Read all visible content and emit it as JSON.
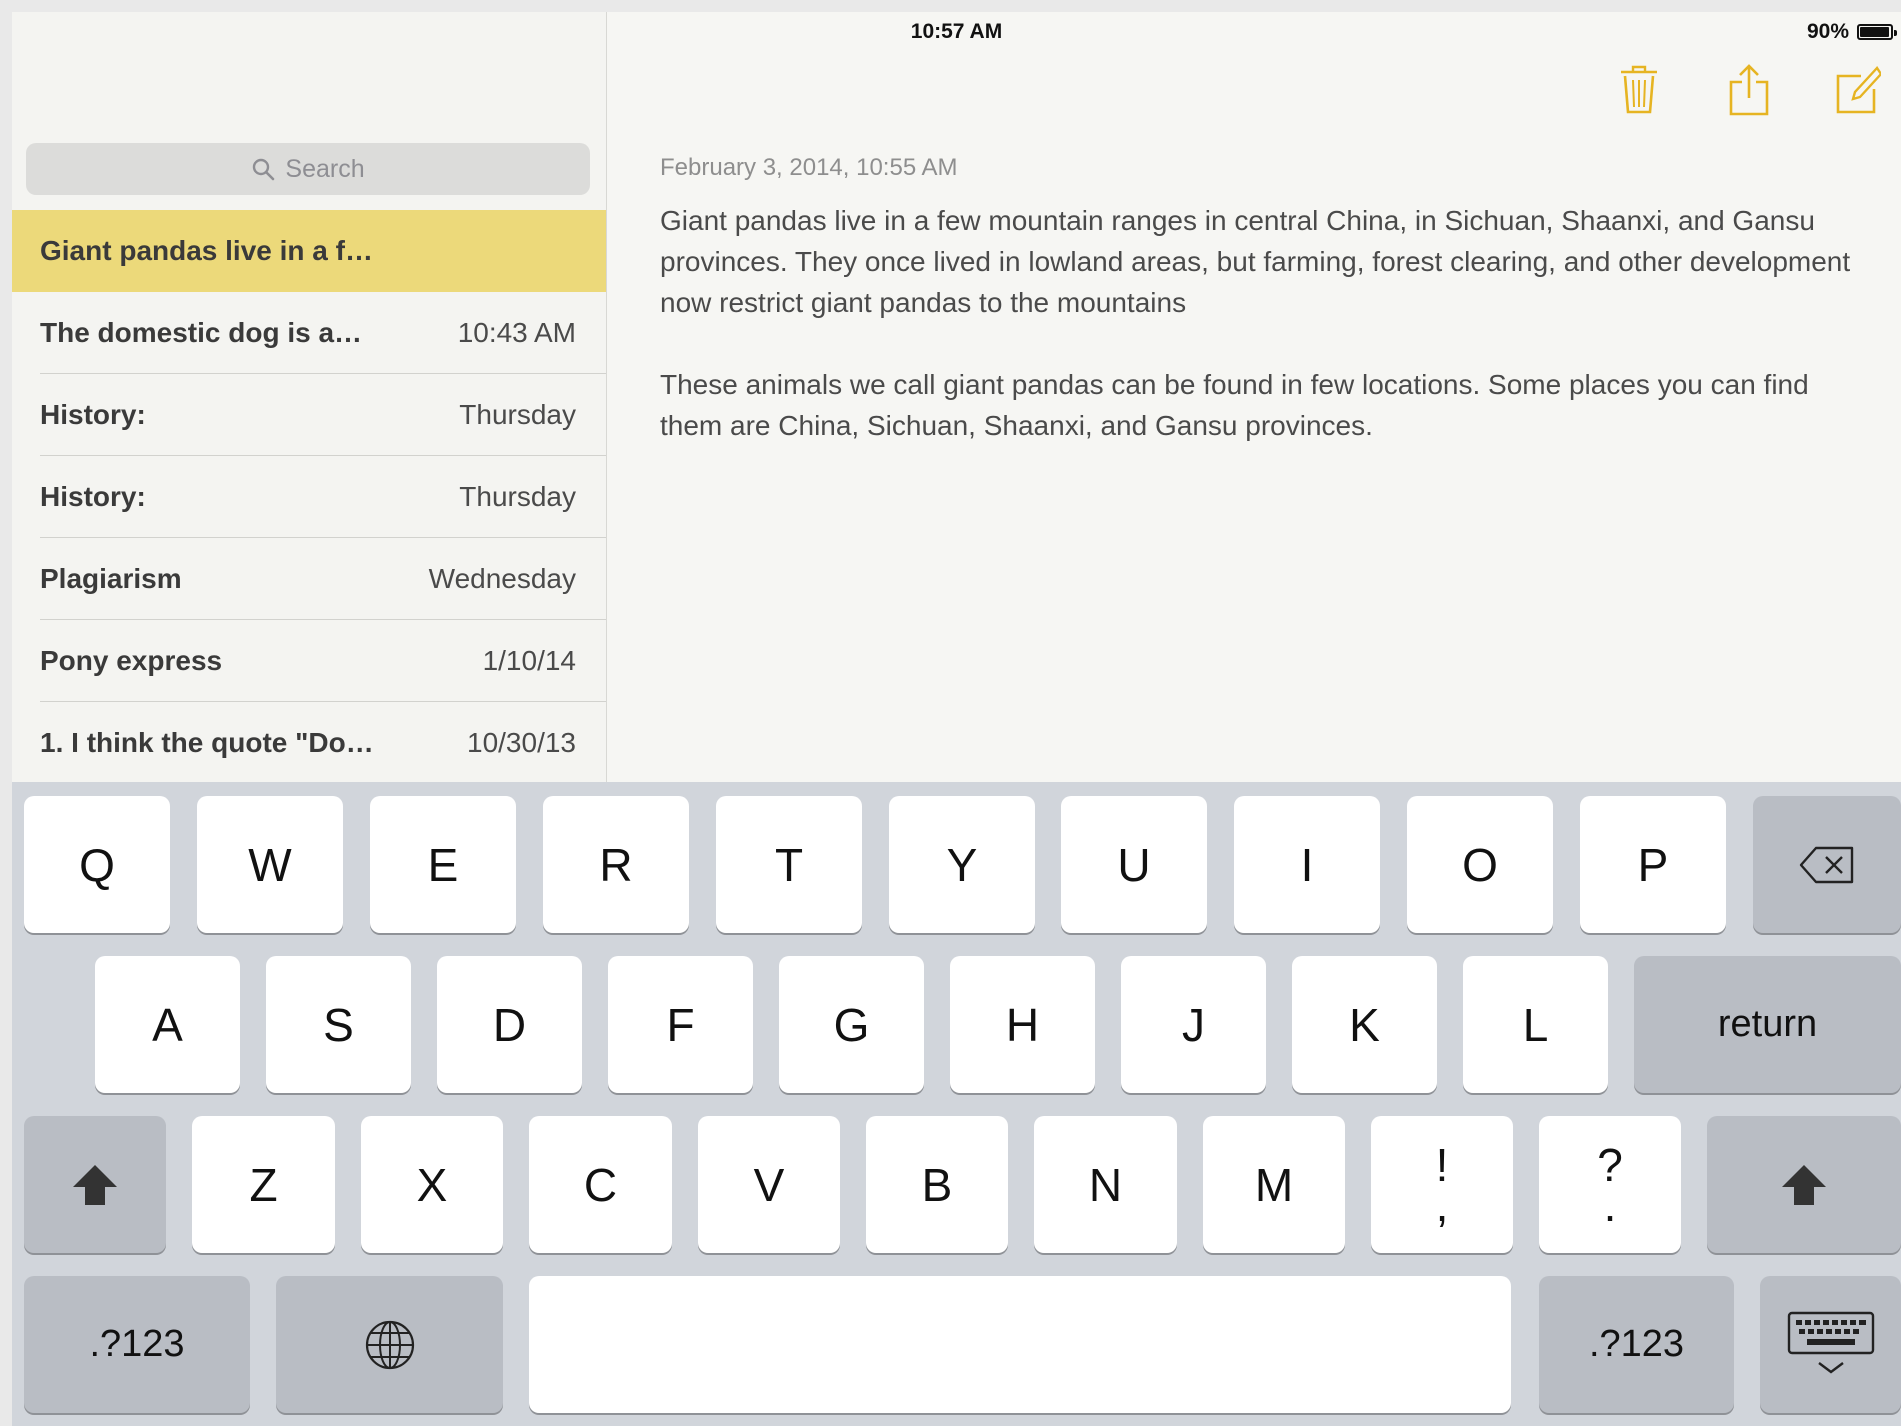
{
  "status_bar": {
    "device": "iPad",
    "time": "10:57 AM",
    "battery": "90%",
    "battery_level": 0.9
  },
  "search": {
    "placeholder": "Search"
  },
  "notes": [
    {
      "title": "Giant pandas live in a f…",
      "date": "",
      "selected": true
    },
    {
      "title": "The domestic dog is a…",
      "date": "10:43 AM"
    },
    {
      "title": "History:",
      "date": "Thursday"
    },
    {
      "title": "History:",
      "date": "Thursday"
    },
    {
      "title": "Plagiarism",
      "date": "Wednesday"
    },
    {
      "title": "Pony express",
      "date": "1/10/14"
    },
    {
      "title": "1. I think the quote \"Do…",
      "date": "10/30/13"
    }
  ],
  "toolbar": {
    "icons": [
      "trash-icon",
      "share-icon",
      "compose-icon"
    ],
    "accent": "#e6b422"
  },
  "note": {
    "date": "February 3, 2014, 10:55 AM",
    "paragraphs": [
      "Giant pandas live in a few mountain ranges in central China, in Sichuan, Shaanxi, and Gansu provinces. They once lived in lowland areas, but farming, forest clearing, and other development now restrict giant pandas to the mountains",
      "These animals we call giant pandas can be found in few locations. Some places you can find them are China, Sichuan, Shaanxi, and Gansu provinces."
    ]
  },
  "keyboard": {
    "row1": [
      "Q",
      "W",
      "E",
      "R",
      "T",
      "Y",
      "U",
      "I",
      "O",
      "P"
    ],
    "row2": [
      "A",
      "S",
      "D",
      "F",
      "G",
      "H",
      "J",
      "K",
      "L"
    ],
    "row3": [
      "Z",
      "X",
      "C",
      "V",
      "B",
      "N",
      "M"
    ],
    "punct1": {
      "top": "!",
      "bottom": ","
    },
    "punct2": {
      "top": "?",
      "bottom": "."
    },
    "return_label": "return",
    "numbers_label": ".?123",
    "icons": [
      "backspace-icon",
      "shift-icon",
      "globe-icon",
      "keyboard-dismiss-icon"
    ]
  }
}
